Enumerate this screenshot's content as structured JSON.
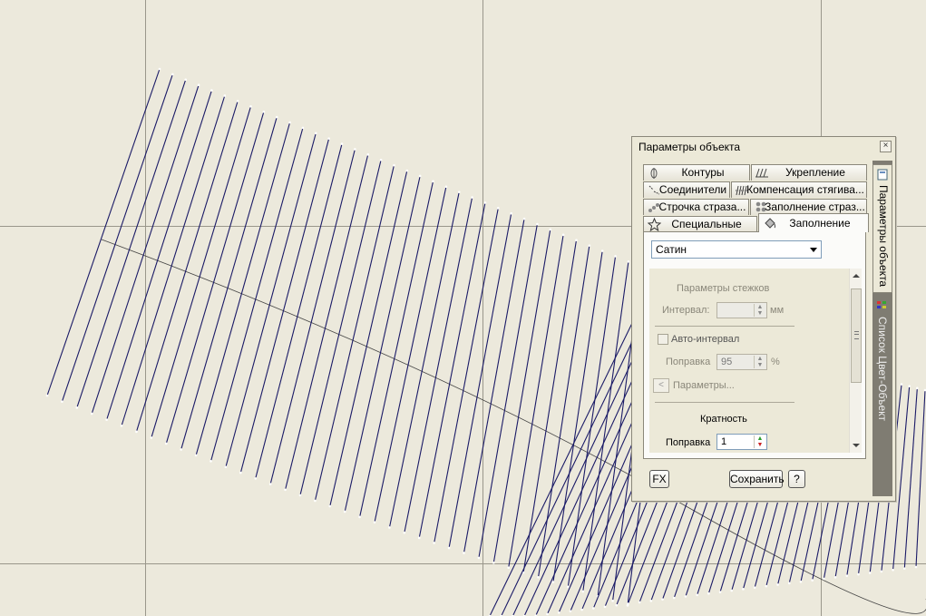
{
  "dialog": {
    "title": "Параметры объекта",
    "close_glyph": "×",
    "tabs": [
      {
        "label": "Контуры",
        "icon": "outline-icon"
      },
      {
        "label": "Укрепление",
        "icon": "underlay-icon"
      },
      {
        "label": "Соединители",
        "icon": "connector-icon"
      },
      {
        "label": "Компенсация стягива...",
        "icon": "pull-compensation-icon"
      },
      {
        "label": "Строчка страза...",
        "icon": "rhinestone-run-icon"
      },
      {
        "label": "Заполнение страз...",
        "icon": "rhinestone-fill-icon"
      },
      {
        "label": "Специальные",
        "icon": "star-icon"
      },
      {
        "label": "Заполнение",
        "icon": "fill-bucket-icon",
        "active": true
      }
    ],
    "fill_type": {
      "selected": "Сатин"
    },
    "stitch_params": {
      "heading": "Параметры стежков",
      "interval_label": "Интервал:",
      "interval_value": "",
      "interval_unit": "мм",
      "auto_interval_label": "Авто-интервал",
      "correction_label": "Поправка",
      "correction_value": "95",
      "correction_unit": "%",
      "params_button_glyph": "<",
      "params_label": "Параметры..."
    },
    "multiplicity": {
      "heading": "Кратность",
      "correction_label": "Поправка",
      "correction_value": "1"
    },
    "buttons": {
      "fx": "FX",
      "save": "Сохранить",
      "help": "?"
    },
    "side_tabs": [
      {
        "label": "Параметры объекта",
        "active": true,
        "icon": "object-properties-icon"
      },
      {
        "label": "Список Цвет-Объект",
        "active": false,
        "icon": "color-object-list-icon"
      }
    ]
  },
  "colors": {
    "canvas_bg": "#ece9dc",
    "stitch": "#1a1a66",
    "grid": "#9a978b",
    "dialog_bg": "#ece9d8",
    "side_strip": "#7f7c72"
  }
}
